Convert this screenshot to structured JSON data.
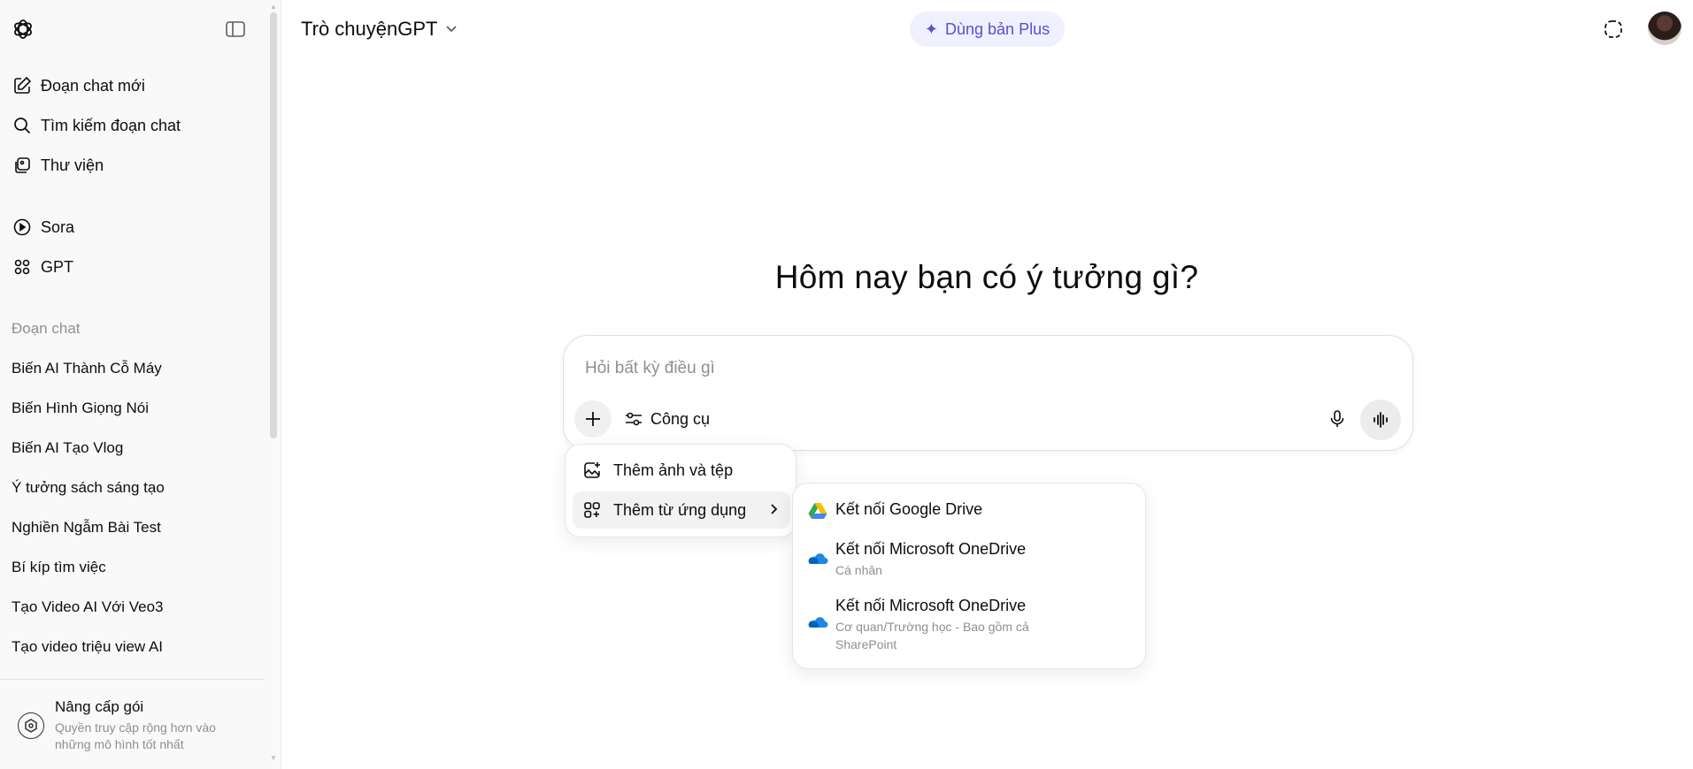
{
  "sidebar": {
    "nav": [
      {
        "label": "Đoạn chat mới",
        "icon": "edit-icon"
      },
      {
        "label": "Tìm kiếm đoạn chat",
        "icon": "search-icon"
      },
      {
        "label": "Thư viện",
        "icon": "library-icon"
      }
    ],
    "apps": [
      {
        "label": "Sora",
        "icon": "play-icon"
      },
      {
        "label": "GPT",
        "icon": "grid-icon"
      }
    ],
    "section_label": "Đoạn chat",
    "chats": [
      "Biến AI Thành Cỗ Máy",
      "Biến Hình Giọng Nói",
      "Biến AI Tạo Vlog",
      "Ý tưởng sách sáng tạo",
      "Nghiền Ngẫm Bài Test",
      "Bí kíp tìm việc",
      "Tạo Video AI Với Veo3",
      "Tạo video triệu view AI"
    ],
    "upgrade": {
      "title": "Nâng cấp gói",
      "subtitle": "Quyền truy cập rộng hơn vào những mô hình tốt nhất"
    }
  },
  "header": {
    "model": "Trò chuyệnGPT",
    "plus_button": "Dùng bản Plus"
  },
  "main": {
    "headline": "Hôm nay bạn có ý tưởng gì?",
    "composer": {
      "placeholder": "Hỏi bất kỳ điều gì",
      "tools_label": "Công cụ"
    },
    "attach_menu": {
      "items": [
        "Thêm ảnh và tệp",
        "Thêm từ ứng dụng"
      ]
    },
    "apps_menu": {
      "items": [
        {
          "title": "Kết nối Google Drive",
          "subtitle": ""
        },
        {
          "title": "Kết nối Microsoft OneDrive",
          "subtitle": "Cá nhân"
        },
        {
          "title": "Kết nối Microsoft OneDrive",
          "subtitle": "Cơ quan/Trường học - Bao gồm cả SharePoint"
        }
      ]
    }
  },
  "colors": {
    "plus_bg": "#f1f0ff",
    "plus_fg": "#5a4fcf",
    "sidebar_bg": "#f9f9f9",
    "muted_text": "#8f8f8f"
  }
}
